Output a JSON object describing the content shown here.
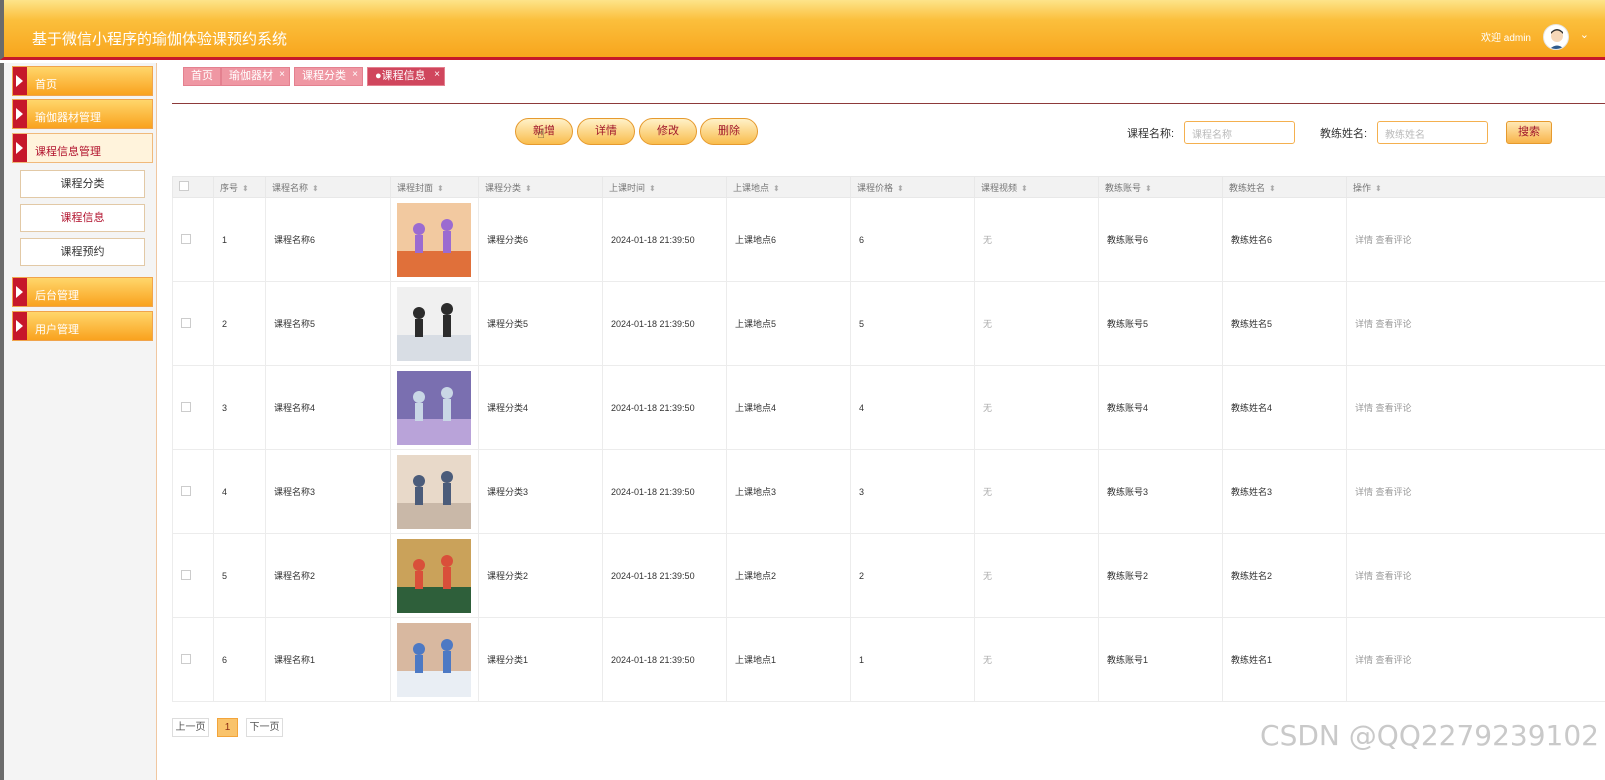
{
  "app": {
    "title": "基于微信小程序的瑜伽体验课预约系统",
    "welcome": "欢迎 admin"
  },
  "sidebar": {
    "items": [
      {
        "label": "首页"
      },
      {
        "label": "瑜伽器材管理"
      },
      {
        "label": "课程信息管理"
      },
      {
        "label": "后台管理"
      },
      {
        "label": "用户管理"
      }
    ],
    "subitems": [
      {
        "label": "课程分类"
      },
      {
        "label": "课程信息"
      },
      {
        "label": "课程预约"
      }
    ]
  },
  "tabs": [
    {
      "label": "首页"
    },
    {
      "label": "瑜伽器材"
    },
    {
      "label": "课程分类"
    },
    {
      "label": "●课程信息"
    }
  ],
  "actions": {
    "add": "新增",
    "detail": "详情",
    "edit": "修改",
    "delete": "删除"
  },
  "search": {
    "course_label": "课程名称:",
    "course_placeholder": "课程名称",
    "coach_label": "教练姓名:",
    "coach_placeholder": "教练姓名",
    "button": "搜索"
  },
  "table": {
    "headers": [
      "序号",
      "课程名称",
      "课程封面",
      "课程分类",
      "上课时间",
      "上课地点",
      "课程价格",
      "课程视频",
      "教练账号",
      "教练姓名",
      "操作"
    ],
    "rows": [
      {
        "no": "1",
        "name": "课程名称6",
        "category": "课程分类6",
        "time": "2024-01-18 21:39:50",
        "place": "上课地点6",
        "price": "6",
        "video": "无",
        "account": "教练账号6",
        "coach": "教练姓名6"
      },
      {
        "no": "2",
        "name": "课程名称5",
        "category": "课程分类5",
        "time": "2024-01-18 21:39:50",
        "place": "上课地点5",
        "price": "5",
        "video": "无",
        "account": "教练账号5",
        "coach": "教练姓名5"
      },
      {
        "no": "3",
        "name": "课程名称4",
        "category": "课程分类4",
        "time": "2024-01-18 21:39:50",
        "place": "上课地点4",
        "price": "4",
        "video": "无",
        "account": "教练账号4",
        "coach": "教练姓名4"
      },
      {
        "no": "4",
        "name": "课程名称3",
        "category": "课程分类3",
        "time": "2024-01-18 21:39:50",
        "place": "上课地点3",
        "price": "3",
        "video": "无",
        "account": "教练账号3",
        "coach": "教练姓名3"
      },
      {
        "no": "5",
        "name": "课程名称2",
        "category": "课程分类2",
        "time": "2024-01-18 21:39:50",
        "place": "上课地点2",
        "price": "2",
        "video": "无",
        "account": "教练账号2",
        "coach": "教练姓名2"
      },
      {
        "no": "6",
        "name": "课程名称1",
        "category": "课程分类1",
        "time": "2024-01-18 21:39:50",
        "place": "上课地点1",
        "price": "1",
        "video": "无",
        "account": "教练账号1",
        "coach": "教练姓名1"
      }
    ],
    "row_ops": {
      "detail": "详情",
      "comments": "查看评论"
    }
  },
  "pager": {
    "prev": "上一页",
    "current": "1",
    "next": "下一页"
  },
  "watermark": "CSDN @QQ2279239102",
  "colors": {
    "accent": "#f8a51d",
    "brand_red": "#c6172a",
    "tab_pink": "#ef97a3"
  }
}
